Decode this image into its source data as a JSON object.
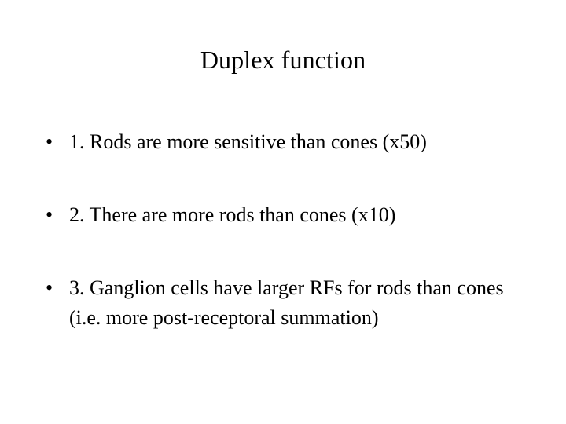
{
  "slide": {
    "title": "Duplex function",
    "background_color": "#ffffff",
    "text_color": "#000000",
    "bullet_glyph": "•",
    "bullets": [
      {
        "marker": "•",
        "text": "1. Rods are more sensitive than cones (x50)"
      },
      {
        "marker": "•",
        "text": "2. There are more rods than cones (x10)"
      },
      {
        "marker": "•",
        "text": "3. Ganglion cells have larger RFs for rods than cones (i.e. more post-receptoral summation)"
      }
    ]
  }
}
